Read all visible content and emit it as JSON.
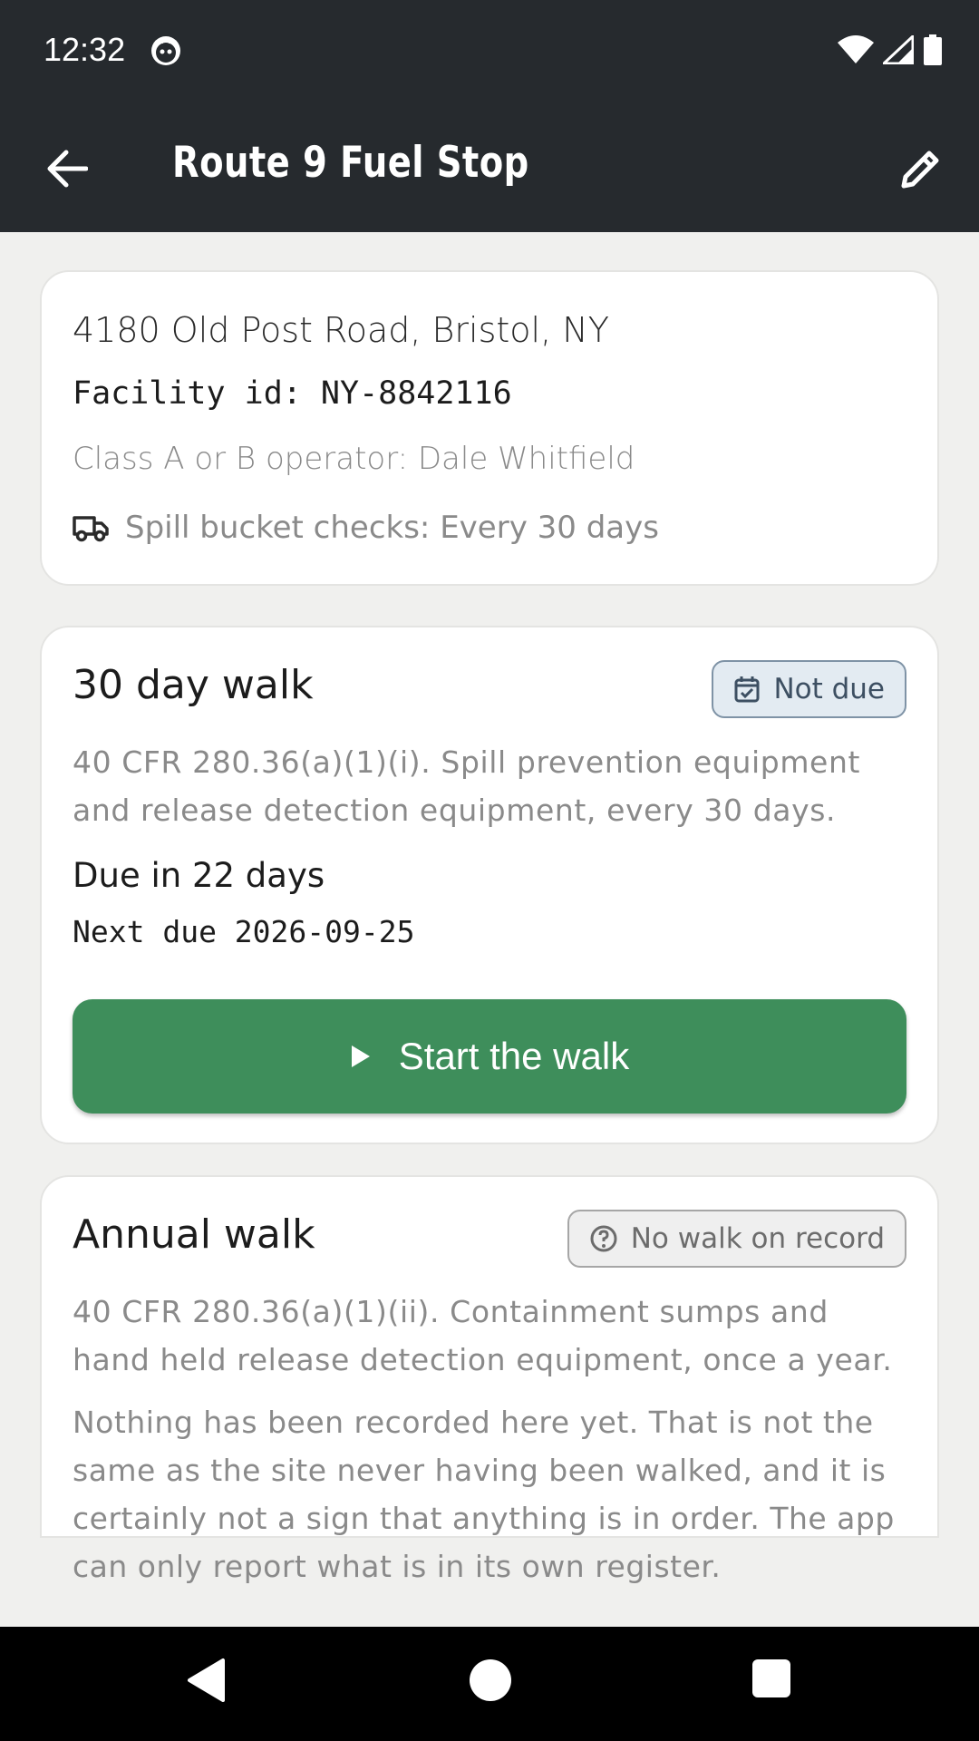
{
  "status_bar": {
    "time": "12:32",
    "icons": [
      "face-icon",
      "wifi-icon",
      "signal-icon",
      "battery-icon"
    ]
  },
  "app_bar": {
    "title": "Route 9 Fuel Stop",
    "back_icon": "arrow-left-icon",
    "edit_icon": "pencil-icon"
  },
  "site": {
    "address": "4180 Old Post Road, Bristol, NY",
    "facility_id": "Facility id: NY-8842116",
    "operator": "Class A or B operator: Dale Whitfield",
    "spill_checks": "Spill bucket checks: Every 30 days",
    "spill_icon": "truck-icon"
  },
  "walk_30": {
    "title": "30 day walk",
    "badge": "Not due",
    "badge_icon": "calendar-check-icon",
    "regulation": "40 CFR 280.36(a)(1)(i). Spill prevention equipment and release detection equipment, every 30 days.",
    "due_in": "Due in 22 days",
    "next_due": "Next due 2026-09-25",
    "start_button": "Start the walk",
    "start_icon": "play-icon"
  },
  "walk_annual": {
    "title": "Annual walk",
    "badge": "No walk on record",
    "badge_icon": "help-circle-icon",
    "regulation": "40 CFR 280.36(a)(1)(ii). Containment sumps and hand held release detection equipment, once a year.",
    "note": "Nothing has been recorded here yet. That is not the same as the site never having been walked, and it is certainly not a sign that anything is in order. The app can only report what is in its own register."
  },
  "colors": {
    "app_bar": "#262a2e",
    "background": "#f0f0ee",
    "primary_button": "#3e8e5b",
    "badge_not_due_bg": "#e3ebf2",
    "badge_not_due_border": "#7f93a6",
    "muted_text": "#8a8a8a"
  }
}
